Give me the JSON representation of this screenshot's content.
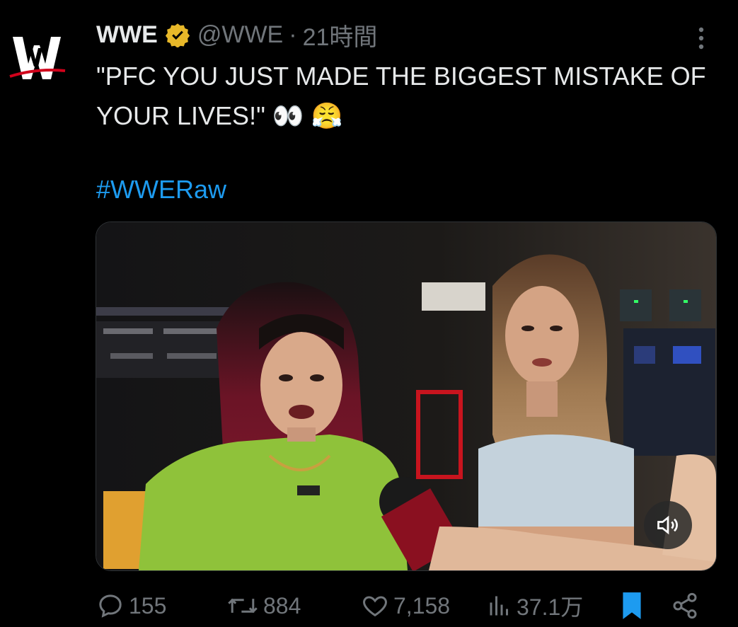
{
  "tweet": {
    "author_name": "WWE",
    "handle": "@WWE",
    "separator": "·",
    "time": "21時間",
    "text": "\"PFC YOU JUST MADE THE BIGGEST MISTAKE OF YOUR LIVES!\"",
    "text_emoji": "👀 😤",
    "hashtag": "#WWERaw"
  },
  "stats": {
    "replies": "155",
    "retweets": "884",
    "likes": "7,158",
    "views": "37.1万"
  },
  "colors": {
    "background": "#000000",
    "text": "#e7e9ea",
    "muted": "#71767b",
    "link": "#1d9bf0",
    "verified": "#e8b829",
    "bookmark": "#1d9bf0"
  },
  "icons": {
    "avatar": "wwe-logo-icon",
    "verified": "verified-badge-icon",
    "more": "more-vertical-icon",
    "sound": "speaker-icon",
    "reply": "reply-icon",
    "retweet": "retweet-icon",
    "like": "heart-icon",
    "views": "views-icon",
    "bookmark": "bookmark-icon",
    "share": "share-icon"
  }
}
